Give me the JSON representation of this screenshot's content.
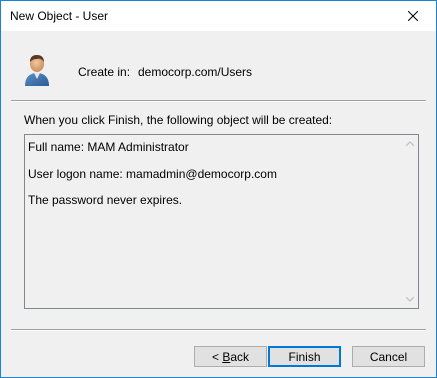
{
  "window": {
    "title": "New Object - User"
  },
  "header": {
    "create_in_label": "Create in:",
    "create_in_value": "democorp.com/Users",
    "icon": "user-icon"
  },
  "intro_text": "When you click Finish, the following object will be created:",
  "summary": {
    "lines": [
      "Full name: MAM Administrator",
      "User logon name: mamadmin@democorp.com",
      "The password never expires."
    ]
  },
  "buttons": {
    "back_mnemonic": "B",
    "back_rest": "ack",
    "back_prefix": "< ",
    "finish": "Finish",
    "cancel": "Cancel"
  },
  "colors": {
    "accent": "#0078d7",
    "border": "#1883d7"
  }
}
